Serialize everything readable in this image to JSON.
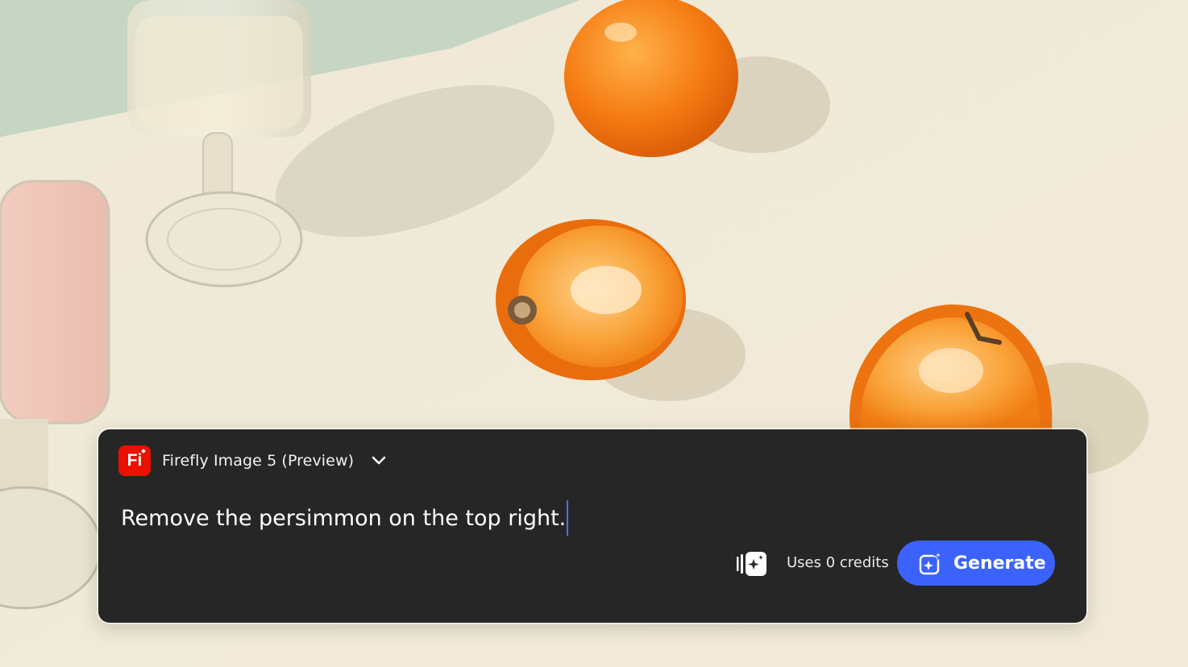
{
  "model": {
    "logo_text": "Fi",
    "name": "Firefly Image 5 (Preview)"
  },
  "prompt": {
    "text": "Remove the persimmon on the top right."
  },
  "credits": {
    "text": "Uses 0 credits"
  },
  "generate_button": {
    "label": "Generate"
  },
  "colors": {
    "panel_bg": "#262626",
    "logo_red": "#EB1000",
    "generate_blue": "#3B63FB",
    "caret_blue": "#4B70F5"
  },
  "icons": {
    "chevron": "chevron-down-icon",
    "credits": "credits-sparkle-icon",
    "generate": "generate-sparkle-icon"
  }
}
